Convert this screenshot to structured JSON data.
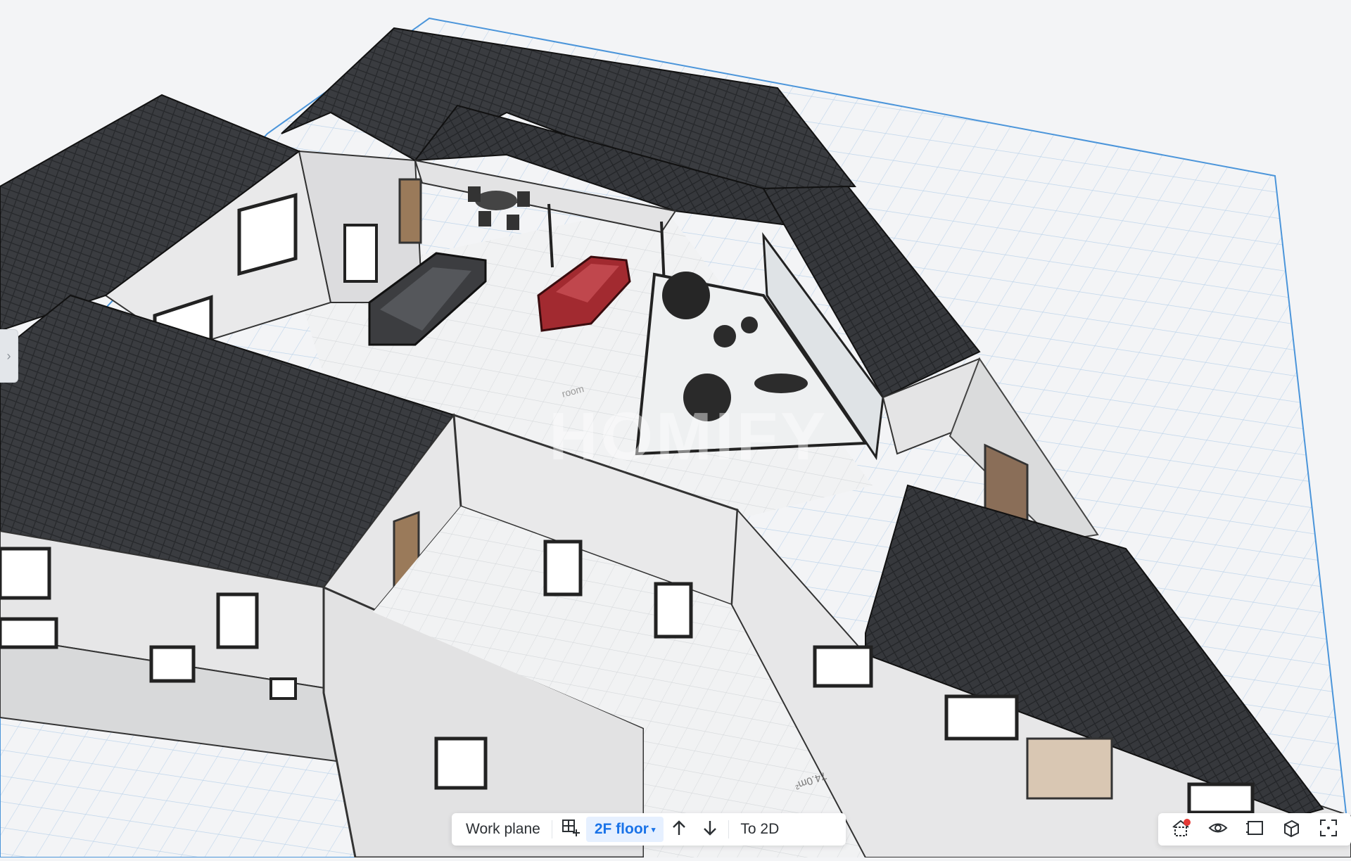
{
  "viewport": {
    "label": "3D model view"
  },
  "watermark": {
    "text": "HOMIFY"
  },
  "annotations": {
    "measure1": "74.0m²",
    "measure2": "room"
  },
  "side_panel": {
    "toggle_icon": "chevron-right-icon"
  },
  "toolbar": {
    "work_plane_label": "Work plane",
    "add_plane_icon": "grid-plus-icon",
    "floor_label": "2F floor",
    "floor_caret": "▾",
    "up_icon": "arrow-up-icon",
    "down_icon": "arrow-down-icon",
    "to_2d_label": "To 2D"
  },
  "view_tools": {
    "items": [
      "home-view-icon",
      "eye-icon",
      "frame-icon",
      "cube-icon",
      "fullscreen-icon"
    ],
    "notification_color": "#e53935"
  },
  "colors": {
    "accent": "#1a73e8",
    "grid_line": "#b8d4ee",
    "plane_border": "#3b8fd9",
    "roof": "#3a3c40",
    "wall": "#e8e8e8"
  }
}
